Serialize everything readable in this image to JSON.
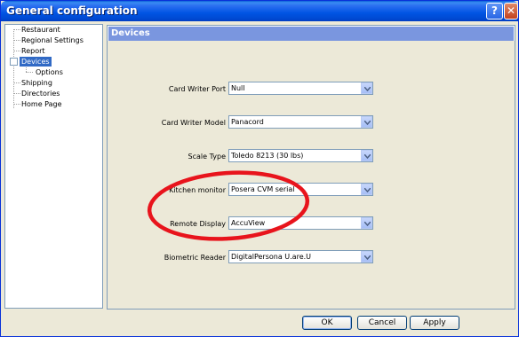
{
  "window": {
    "title": "General configuration",
    "help_glyph": "?",
    "close_glyph": "✕"
  },
  "tree": {
    "items": [
      {
        "label": "Restaurant"
      },
      {
        "label": "Regional Settings"
      },
      {
        "label": "Report"
      },
      {
        "label": "Devices",
        "selected": true,
        "expander": "⊟"
      },
      {
        "label": "Options"
      },
      {
        "label": "Shipping"
      },
      {
        "label": "Directories"
      },
      {
        "label": "Home Page"
      }
    ]
  },
  "panel": {
    "header": "Devices",
    "fields": [
      {
        "label": "Card Writer Port",
        "value": "Null"
      },
      {
        "label": "Card Writer Model",
        "value": "Panacord"
      },
      {
        "label": "Scale Type",
        "value": "Toledo 8213 (30 lbs)"
      },
      {
        "label": "Kitchen monitor",
        "value": "Posera CVM serial"
      },
      {
        "label": "Remote Display",
        "value": "AccuView"
      },
      {
        "label": "Biometric Reader",
        "value": "DigitalPersona U.are.U"
      }
    ]
  },
  "annotation": {
    "color": "#e8141c",
    "shape": "ellipse"
  },
  "buttons": {
    "ok": "OK",
    "cancel": "Cancel",
    "apply": "Apply"
  },
  "colors": {
    "titlebar": "#0054e3",
    "selection": "#316ac5",
    "panel_header": "#7a96df",
    "dialog_bg": "#ece9d8"
  }
}
